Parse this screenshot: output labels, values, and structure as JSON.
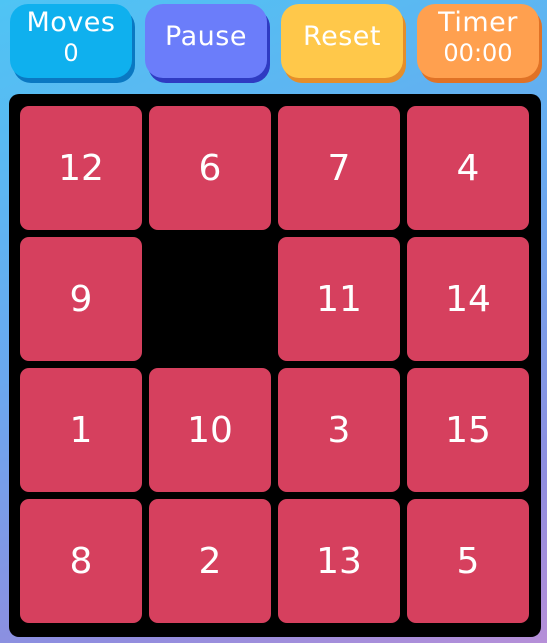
{
  "header": {
    "moves_label": "Moves",
    "moves_value": "0",
    "pause_label": "Pause",
    "reset_label": "Reset",
    "timer_label": "Timer",
    "timer_value": "00:00"
  },
  "board": {
    "rows": 4,
    "cols": 4,
    "tiles": [
      "12",
      "6",
      "7",
      "4",
      "9",
      "",
      "11",
      "14",
      "1",
      "10",
      "3",
      "15",
      "8",
      "2",
      "13",
      "5"
    ]
  },
  "colors": {
    "tile": "#d6405e",
    "board": "#000000",
    "moves_button": "#0fb0ee",
    "pause_button": "#6b7dfa",
    "reset_button": "#ffc84a",
    "timer_button": "#ffa04f"
  }
}
